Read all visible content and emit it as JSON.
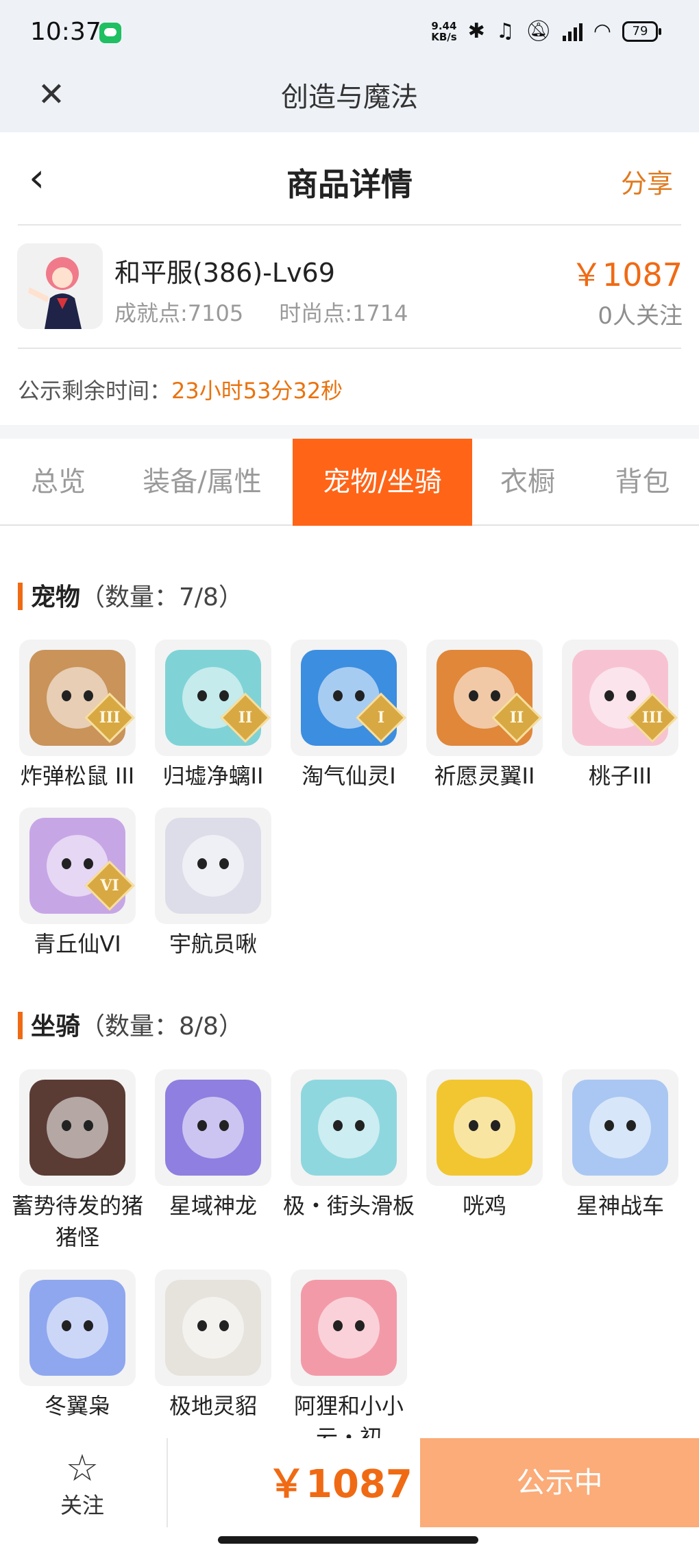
{
  "status": {
    "time": "10:37",
    "speed_value": "9.44",
    "speed_unit": "KB/s",
    "battery": "79"
  },
  "app": {
    "title": "创造与魔法"
  },
  "header": {
    "title": "商品详情",
    "share": "分享"
  },
  "product": {
    "name": "和平服(386)-Lv69",
    "achievement": "成就点:7105",
    "fashion": "时尚点:1714",
    "price": "￥1087",
    "followers": "0人关注"
  },
  "notice": {
    "label": "公示剩余时间：",
    "countdown": "23小时53分32秒"
  },
  "tabs": [
    "总览",
    "装备/属性",
    "宠物/坐骑",
    "衣橱",
    "背包"
  ],
  "pets": {
    "title": "宠物",
    "count": "（数量：7/8）",
    "items": [
      {
        "name": "炸弹松鼠 III",
        "badge": "III",
        "color": "#c9935a"
      },
      {
        "name": "归墟净螭II",
        "badge": "II",
        "color": "#7fd3d6"
      },
      {
        "name": "淘气仙灵I",
        "badge": "I",
        "color": "#3c8ee0"
      },
      {
        "name": "祈愿灵翼II",
        "badge": "II",
        "color": "#e0873a"
      },
      {
        "name": "桃子III",
        "badge": "III",
        "color": "#f7c3d2"
      },
      {
        "name": "青丘仙VI",
        "badge": "VI",
        "color": "#c7a6e6"
      },
      {
        "name": "宇航员啾",
        "badge": "",
        "color": "#dcdde8"
      }
    ]
  },
  "mounts": {
    "title": "坐骑",
    "count": "（数量：8/8）",
    "items": [
      {
        "name": "蓄势待发的猪猪怪",
        "color": "#5a3c35"
      },
      {
        "name": "星域神龙",
        "color": "#8e7fe0"
      },
      {
        "name": "极・街头滑板",
        "color": "#8fd7df"
      },
      {
        "name": "咣鸡",
        "color": "#f2c631"
      },
      {
        "name": "星神战车",
        "color": "#a9c7f2"
      },
      {
        "name": "冬翼枭",
        "color": "#8fa7ef"
      },
      {
        "name": "极地灵貂",
        "color": "#e6e2dc"
      },
      {
        "name": "阿狸和小小云・初",
        "color": "#f39aa8"
      }
    ]
  },
  "bottom": {
    "follow_label": "关注",
    "price": "￥1087",
    "cta": "公示中"
  }
}
